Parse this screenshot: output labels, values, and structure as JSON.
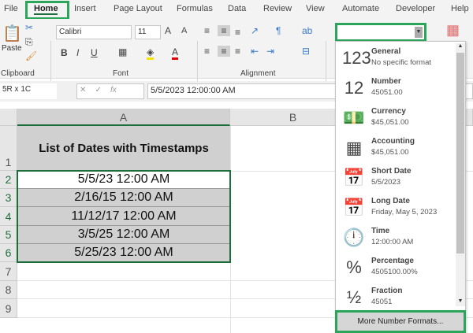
{
  "tabs": [
    "File",
    "Home",
    "Insert",
    "Page Layout",
    "Formulas",
    "Data",
    "Review",
    "View",
    "Automate",
    "Developer",
    "Help"
  ],
  "ribbon": {
    "paste": "Paste",
    "font_name": "Calibri",
    "font_size": "11",
    "groups": [
      "Clipboard",
      "Font",
      "Alignment"
    ]
  },
  "formula_bar": {
    "name_box": "5R x 1C",
    "formula": "5/5/2023  12:00:00 AM",
    "fx": "fx"
  },
  "columns": [
    "A",
    "B"
  ],
  "rows": [
    "1",
    "2",
    "3",
    "4",
    "5",
    "6",
    "7",
    "8",
    "9"
  ],
  "cells": {
    "title": "List of Dates with Timestamps",
    "dates": [
      "5/5/23 12:00 AM",
      "2/16/15 12:00 AM",
      "11/12/17 12:00 AM",
      "3/5/25 12:00 AM",
      "5/25/23 12:00 AM"
    ]
  },
  "number_format": {
    "current": "",
    "items": [
      {
        "title": "General",
        "sub": "No specific format",
        "icon": "123"
      },
      {
        "title": "Number",
        "sub": "45051.00",
        "icon": "12"
      },
      {
        "title": "Currency",
        "sub": "$45,051.00",
        "icon": "💵"
      },
      {
        "title": "Accounting",
        "sub": " $45,051.00",
        "icon": "▦"
      },
      {
        "title": "Short Date",
        "sub": "5/5/2023",
        "icon": "📅"
      },
      {
        "title": "Long Date",
        "sub": "Friday, May 5, 2023",
        "icon": "📅"
      },
      {
        "title": "Time",
        "sub": "12:00:00 AM",
        "icon": "🕛"
      },
      {
        "title": "Percentage",
        "sub": "4505100.00%",
        "icon": "%"
      },
      {
        "title": "Fraction",
        "sub": "45051",
        "icon": "½"
      }
    ],
    "more": "More Number Formats..."
  },
  "colors": {
    "highlight": "#2aa55a",
    "selected_fill": "#d0d0d0"
  }
}
